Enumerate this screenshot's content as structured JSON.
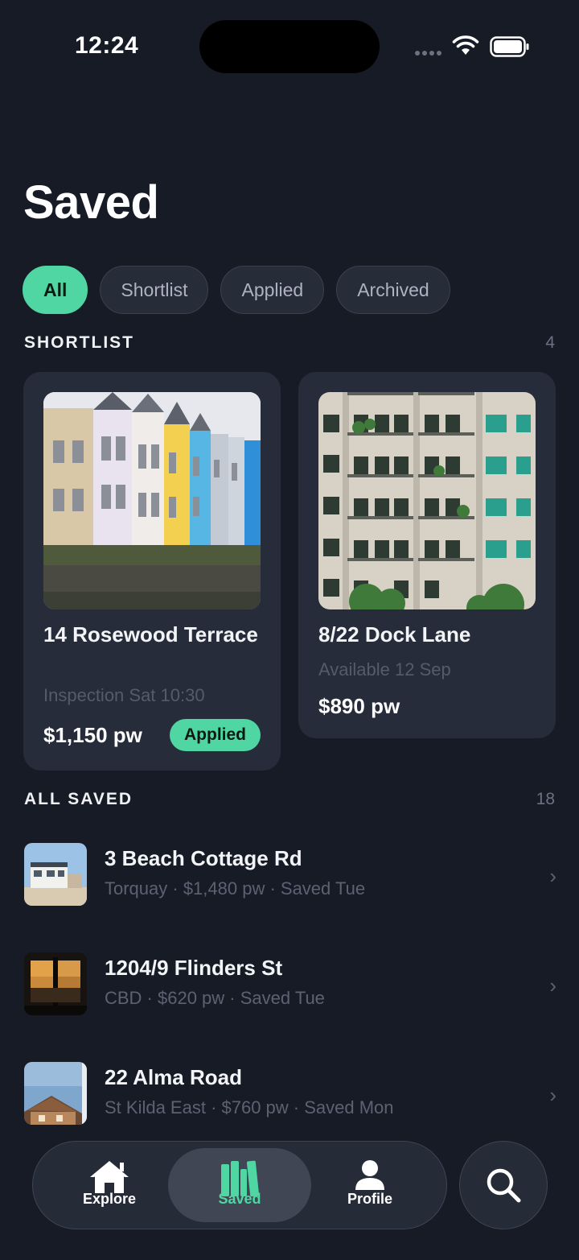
{
  "status_bar": {
    "time": "12:24"
  },
  "title": "Saved",
  "filters": [
    "All",
    "Shortlist",
    "Applied",
    "Archived"
  ],
  "shortlist": {
    "heading": "SHORTLIST",
    "count": "4",
    "cards": [
      {
        "title": "14 Rosewood Terrace",
        "subtitle": "Inspection Sat 10:30",
        "price": "$1,150 pw",
        "badge": "Applied"
      },
      {
        "title": "8/22 Dock Lane",
        "subtitle": "Available 12 Sep",
        "price": "$890 pw"
      }
    ]
  },
  "all_saved": {
    "heading": "ALL SAVED",
    "count": "18",
    "items": [
      {
        "title": "3 Beach Cottage Rd",
        "subtitle": "Torquay · $1,480 pw · Saved Tue"
      },
      {
        "title": "1204/9 Flinders St",
        "subtitle": "CBD · $620 pw · Saved Tue"
      },
      {
        "title": "22 Alma Road",
        "subtitle": "St Kilda East · $760 pw · Saved Mon"
      }
    ]
  },
  "tabbar": {
    "tabs": [
      {
        "label": "Explore",
        "icon": "house-icon"
      },
      {
        "label": "Saved",
        "icon": "books-icon"
      },
      {
        "label": "Profile",
        "icon": "person-icon"
      }
    ],
    "active": "Saved",
    "search_icon": "search-icon"
  },
  "colors": {
    "background": "#171b26",
    "card": "#272c3a",
    "accent": "#4fd6a3"
  }
}
